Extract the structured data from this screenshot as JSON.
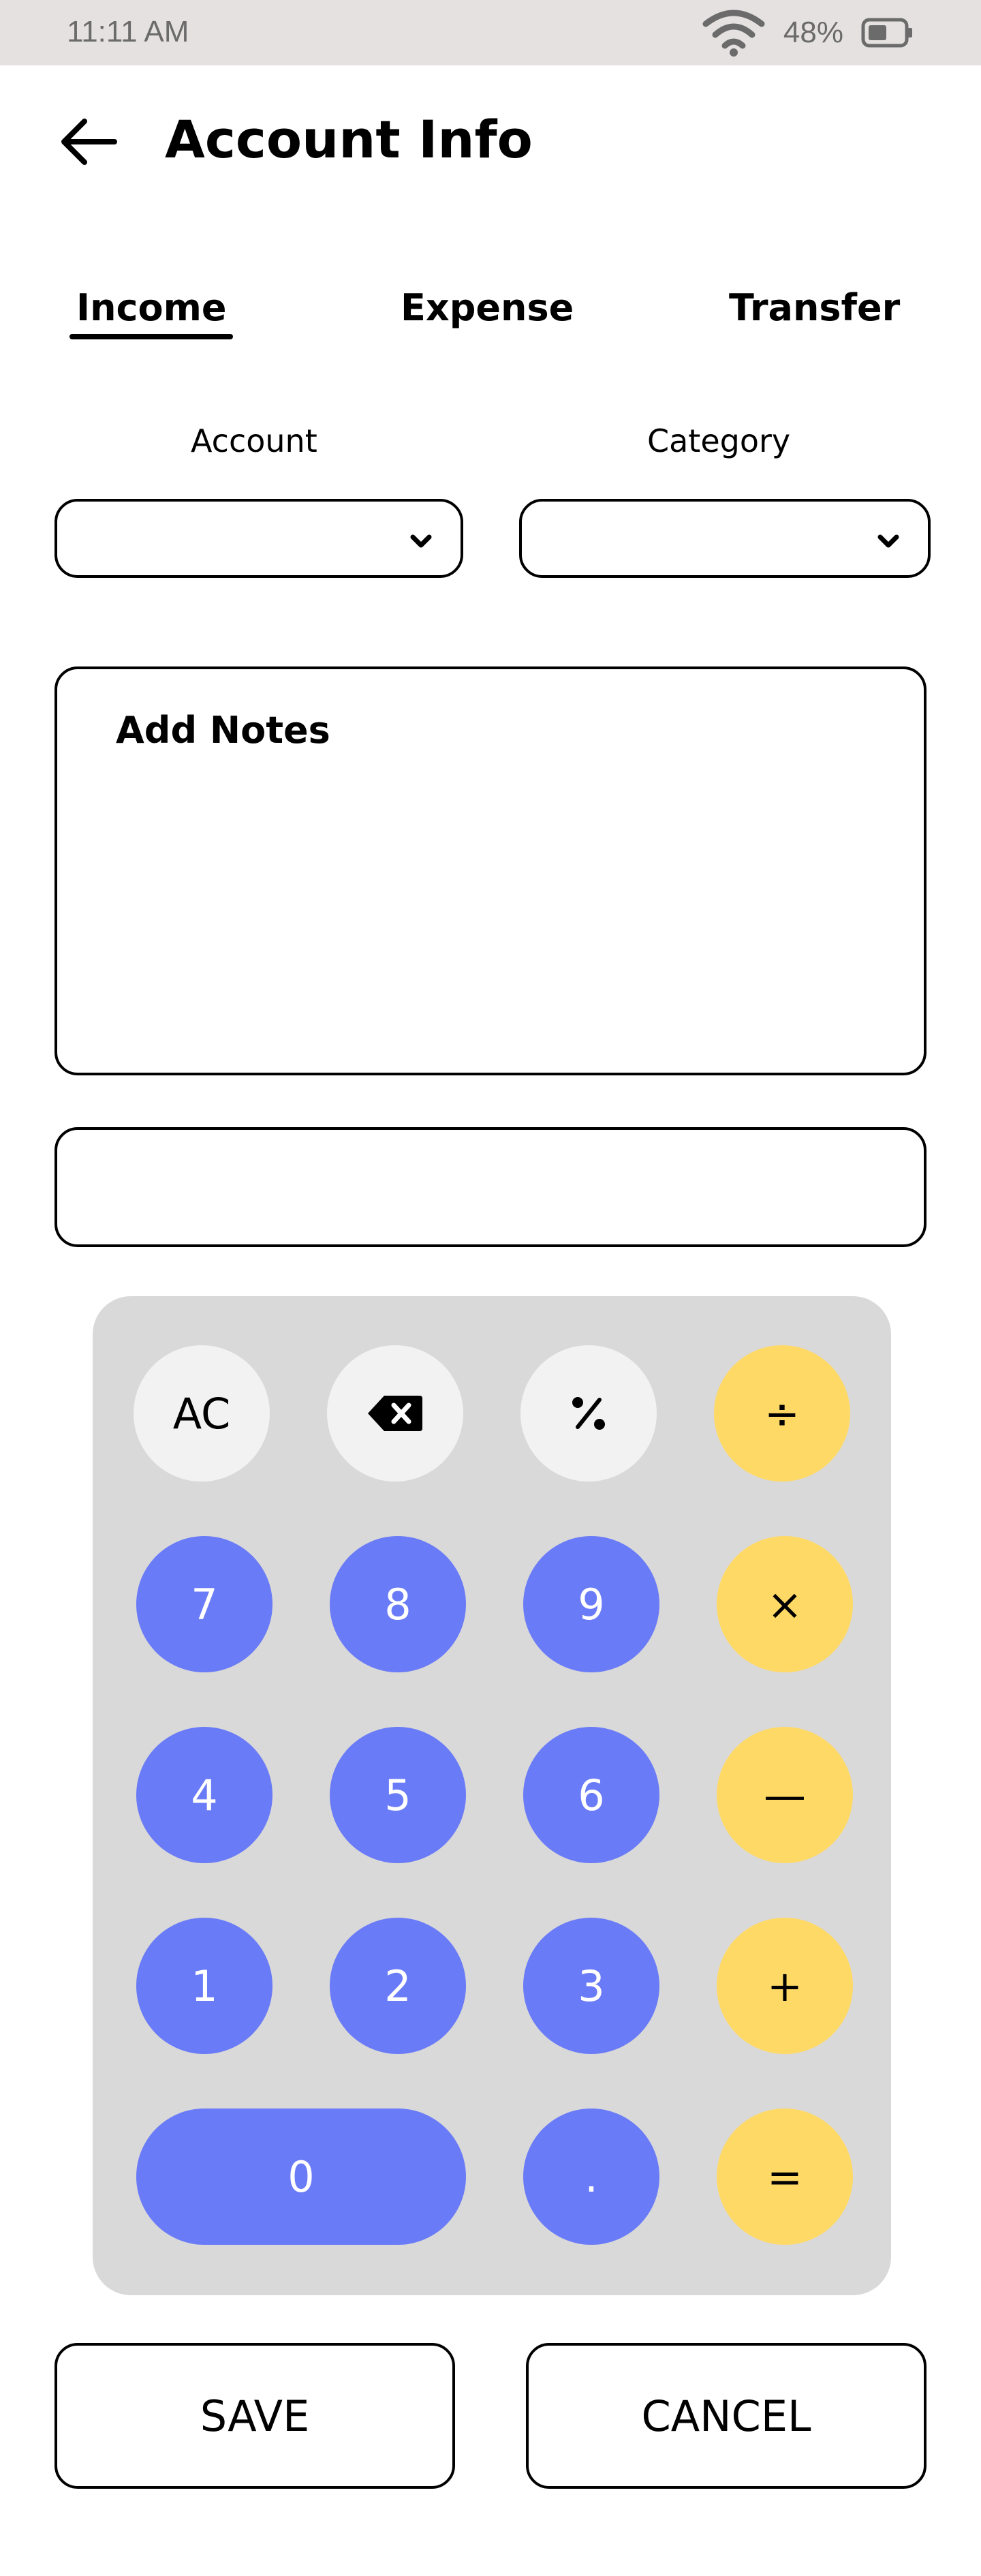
{
  "status_bar": {
    "time": "11:11 AM",
    "battery": "48%"
  },
  "header": {
    "title": "Account Info"
  },
  "tabs": [
    {
      "label": "Income",
      "active": true
    },
    {
      "label": "Expense",
      "active": false
    },
    {
      "label": "Transfer",
      "active": false
    }
  ],
  "form": {
    "account_label": "Account",
    "category_label": "Category",
    "account_value": "",
    "category_value": "",
    "notes_placeholder": "Add Notes",
    "amount_value": ""
  },
  "calculator": {
    "keys": {
      "ac": "AC",
      "seven": "7",
      "eight": "8",
      "nine": "9",
      "four": "4",
      "five": "5",
      "six": "6",
      "one": "1",
      "two": "2",
      "three": "3",
      "zero": "0",
      "dot": ".",
      "divide": "÷",
      "multiply": "×",
      "minus": "—",
      "plus": "+",
      "equals": "="
    },
    "icons": {
      "backspace": "backspace-icon",
      "percent": "percent-icon"
    }
  },
  "actions": {
    "save": "SAVE",
    "cancel": "CANCEL"
  },
  "colors": {
    "status_bar": "#e5e1e1",
    "keypad_bg": "#d9d9d9",
    "key_light": "#f2f2f2",
    "key_blue": "#6a7bf7",
    "key_yellow": "#ffd966"
  }
}
